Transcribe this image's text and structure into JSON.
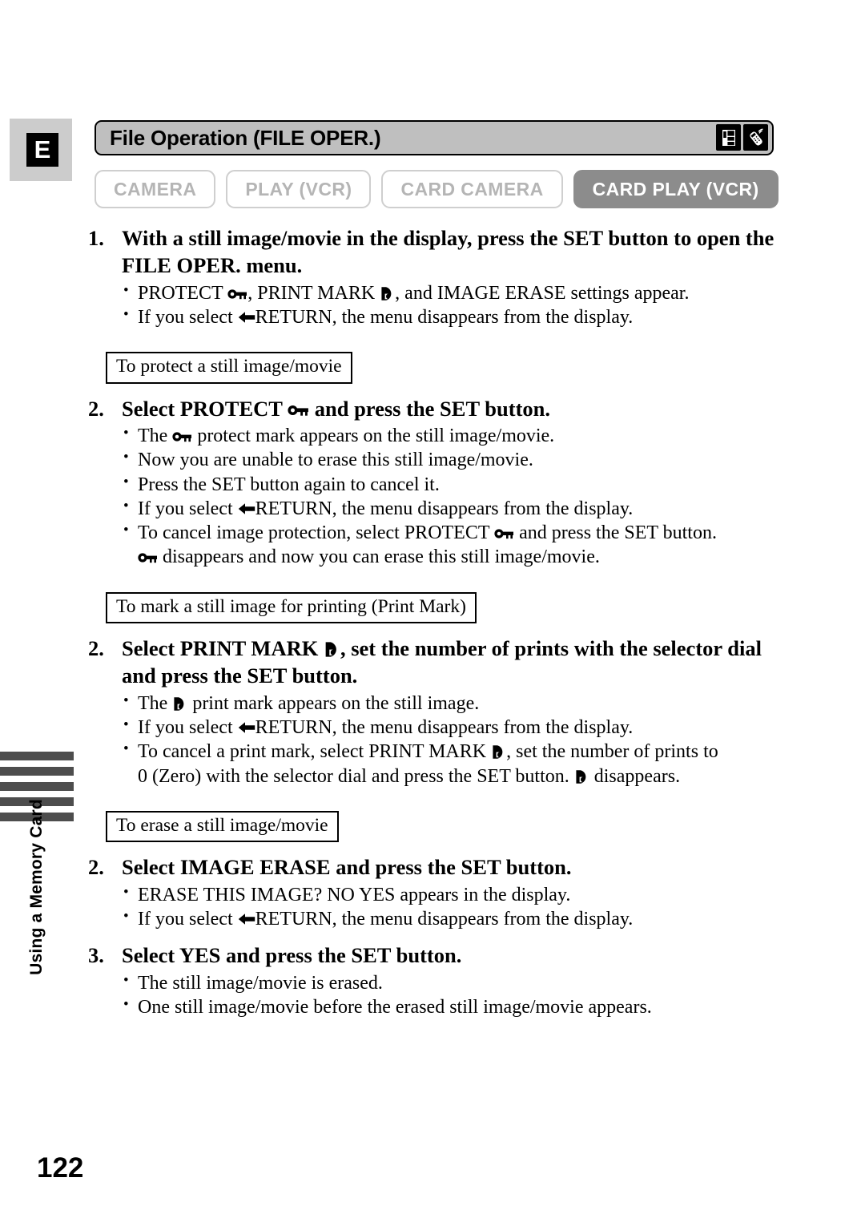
{
  "page": {
    "language_badge": "E",
    "page_number": "122",
    "side_tab_label": "Using a Memory Card",
    "side_tab_bar_count": 5
  },
  "header": {
    "title": "File Operation (FILE OPER.)",
    "icons": [
      {
        "name": "memory-card-icon",
        "label": "memory card"
      },
      {
        "name": "wireless-controller-icon",
        "label": "wireless controller"
      }
    ]
  },
  "mode_buttons": [
    {
      "label": "CAMERA",
      "active": false
    },
    {
      "label": "PLAY (VCR)",
      "active": false
    },
    {
      "label": "CARD CAMERA",
      "active": false
    },
    {
      "label": "CARD PLAY (VCR)",
      "active": true
    }
  ],
  "steps": [
    {
      "number": "1.",
      "heading": "With a still image/movie in the display, press the SET button to open the FILE OPER. menu.",
      "bullets": [
        {
          "segments": [
            {
              "t": "text",
              "v": "PROTECT "
            },
            {
              "t": "icon",
              "v": "key-icon"
            },
            {
              "t": "text",
              "v": ", PRINT MARK "
            },
            {
              "t": "icon",
              "v": "print-mark-icon"
            },
            {
              "t": "text",
              "v": ", and IMAGE ERASE settings appear."
            }
          ]
        },
        {
          "segments": [
            {
              "t": "text",
              "v": "If you select "
            },
            {
              "t": "icon",
              "v": "return-arrow-icon"
            },
            {
              "t": "text",
              "v": "RETURN, the menu disappears from the display."
            }
          ]
        }
      ]
    }
  ],
  "sections": [
    {
      "box_label": "To protect a still image/movie",
      "step": {
        "number": "2.",
        "heading_segments": [
          {
            "t": "text",
            "v": "Select PROTECT "
          },
          {
            "t": "icon",
            "v": "key-icon"
          },
          {
            "t": "text",
            "v": " and press the SET button."
          }
        ],
        "bullets": [
          {
            "segments": [
              {
                "t": "text",
                "v": "The "
              },
              {
                "t": "icon",
                "v": "key-icon"
              },
              {
                "t": "text",
                "v": " protect mark appears on the still image/movie."
              }
            ]
          },
          {
            "segments": [
              {
                "t": "text",
                "v": "Now you are unable to erase this still image/movie."
              }
            ]
          },
          {
            "segments": [
              {
                "t": "text",
                "v": "Press the SET button again to cancel it."
              }
            ]
          },
          {
            "segments": [
              {
                "t": "text",
                "v": "If you select "
              },
              {
                "t": "icon",
                "v": "return-arrow-icon"
              },
              {
                "t": "text",
                "v": "RETURN, the menu disappears from the display."
              }
            ]
          },
          {
            "segments": [
              {
                "t": "text",
                "v": "To cancel image protection, select PROTECT "
              },
              {
                "t": "icon",
                "v": "key-icon"
              },
              {
                "t": "text",
                "v": " and press the SET button."
              }
            ]
          },
          {
            "continuation": true,
            "segments": [
              {
                "t": "icon",
                "v": "key-icon"
              },
              {
                "t": "text",
                "v": " disappears and now you can erase this still image/movie."
              }
            ]
          }
        ]
      }
    },
    {
      "box_label": "To mark a still image for printing (Print Mark)",
      "step": {
        "number": "2.",
        "heading_segments": [
          {
            "t": "text",
            "v": "Select PRINT MARK "
          },
          {
            "t": "icon",
            "v": "print-mark-icon"
          },
          {
            "t": "text",
            "v": ", set the number of prints with the selector dial and press the SET button."
          }
        ],
        "bullets": [
          {
            "segments": [
              {
                "t": "text",
                "v": "The "
              },
              {
                "t": "icon",
                "v": "print-mark-icon"
              },
              {
                "t": "text",
                "v": " print mark appears on the still image."
              }
            ]
          },
          {
            "segments": [
              {
                "t": "text",
                "v": "If you select "
              },
              {
                "t": "icon",
                "v": "return-arrow-icon"
              },
              {
                "t": "text",
                "v": "RETURN, the menu disappears from the display."
              }
            ]
          },
          {
            "segments": [
              {
                "t": "text",
                "v": "To cancel a print mark, select PRINT MARK "
              },
              {
                "t": "icon",
                "v": "print-mark-icon"
              },
              {
                "t": "text",
                "v": ", set the number of prints to"
              }
            ]
          },
          {
            "continuation": true,
            "segments": [
              {
                "t": "text",
                "v": "0 (Zero) with the selector dial and press the SET button. "
              },
              {
                "t": "icon",
                "v": "print-mark-icon"
              },
              {
                "t": "text",
                "v": " disappears."
              }
            ]
          }
        ]
      }
    },
    {
      "box_label": "To erase a still image/movie",
      "step": {
        "number": "2.",
        "heading_segments": [
          {
            "t": "text",
            "v": "Select IMAGE ERASE and press the SET button."
          }
        ],
        "bullets": [
          {
            "segments": [
              {
                "t": "text",
                "v": "ERASE THIS IMAGE? NO YES appears in the display."
              }
            ]
          },
          {
            "segments": [
              {
                "t": "text",
                "v": "If you select "
              },
              {
                "t": "icon",
                "v": "return-arrow-icon"
              },
              {
                "t": "text",
                "v": "RETURN, the menu disappears from the display."
              }
            ]
          }
        ]
      },
      "step2": {
        "number": "3.",
        "heading_segments": [
          {
            "t": "text",
            "v": "Select YES and press the SET button."
          }
        ],
        "bullets": [
          {
            "segments": [
              {
                "t": "text",
                "v": "The still image/movie is erased."
              }
            ]
          },
          {
            "segments": [
              {
                "t": "text",
                "v": "One still image/movie before the erased still image/movie appears."
              }
            ]
          }
        ]
      }
    }
  ]
}
